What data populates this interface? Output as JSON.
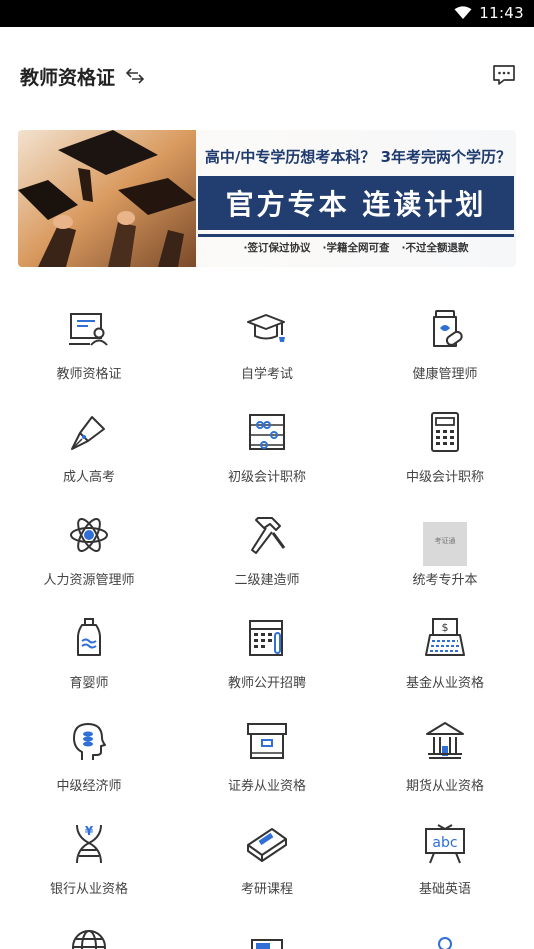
{
  "status_bar": {
    "time": "11:43",
    "wifi_icon": "wifi-icon"
  },
  "header": {
    "title": "教师资格证",
    "switch_icon": "swap-arrows-icon",
    "message_icon": "message-icon"
  },
  "banner": {
    "headline": "高中/中专学历想考本科？ 3年考完两个学历？",
    "cta": "官方专本  连读计划",
    "features": [
      "·签订保过协议",
      "·学籍全网可查",
      "·不过全额退款"
    ]
  },
  "grid": {
    "items": [
      {
        "label": "教师资格证",
        "icon": "teacher-certificate-icon"
      },
      {
        "label": "自学考试",
        "icon": "graduation-cap-icon"
      },
      {
        "label": "健康管理师",
        "icon": "medicine-bottle-icon"
      },
      {
        "label": "成人高考",
        "icon": "fountain-pen-icon"
      },
      {
        "label": "初级会计职称",
        "icon": "abacus-icon"
      },
      {
        "label": "中级会计职称",
        "icon": "calculator-icon"
      },
      {
        "label": "人力资源管理师",
        "icon": "atom-icon"
      },
      {
        "label": "二级建造师",
        "icon": "hammer-icon"
      },
      {
        "label": "统考专升本",
        "icon": "placeholder-thumbnail",
        "thumb_text": "考证通"
      },
      {
        "label": "育婴师",
        "icon": "baby-bottle-icon"
      },
      {
        "label": "教师公开招聘",
        "icon": "exam-sheet-icon"
      },
      {
        "label": "基金从业资格",
        "icon": "cash-register-icon"
      },
      {
        "label": "中级经济师",
        "icon": "head-coins-icon"
      },
      {
        "label": "证券从业资格",
        "icon": "archive-box-icon"
      },
      {
        "label": "期货从业资格",
        "icon": "bank-icon"
      },
      {
        "label": "银行从业资格",
        "icon": "yen-dna-icon"
      },
      {
        "label": "考研课程",
        "icon": "textbook-icon"
      },
      {
        "label": "基础英语",
        "icon": "abc-easel-icon"
      }
    ],
    "partial_row_icons": [
      "globe-icon",
      "book-icon",
      "person-icon"
    ]
  },
  "colors": {
    "accent_blue": "#2f6fd6",
    "icon_dark": "#333333",
    "banner_navy": "#223d6f"
  }
}
